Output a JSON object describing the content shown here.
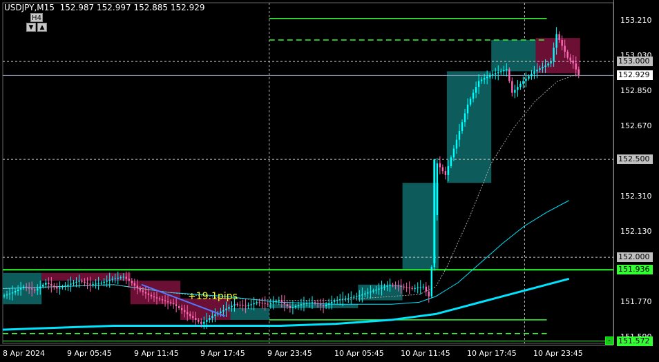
{
  "header": {
    "symbol": "USDJPY,M15",
    "ohlc": "152.987 152.997 152.885 152.929"
  },
  "timeframe": {
    "label": "H4",
    "down_glyph": "▼",
    "up_glyph": "▲"
  },
  "annotation": {
    "pips": "+19.1pips"
  },
  "minimize_glyph": "-",
  "colors": {
    "background": "#000000",
    "bull_box": "#0e5b5b",
    "bear_box": "#6b0f35",
    "candle": "#00ffff",
    "candle_bear": "#ff69b4",
    "level_green": "#33ff33",
    "ma_fast": "#00e5ff",
    "ma_slow": "#00e5ff"
  },
  "chart_data": {
    "type": "candlestick",
    "symbol": "USDJPY",
    "timeframe": "M15",
    "y_ticks": [
      "153.210",
      "153.030",
      "152.850",
      "152.670",
      "152.310",
      "152.130",
      "151.770",
      "151.590"
    ],
    "x_ticks": [
      "8 Apr 2024",
      "9 Apr 05:45",
      "9 Apr 11:45",
      "9 Apr 17:45",
      "9 Apr 23:45",
      "10 Apr 05:45",
      "10 Apr 11:45",
      "10 Apr 17:45",
      "10 Apr 23:45"
    ],
    "ylim": [
      151.56,
      153.3
    ],
    "current_price": "152.929",
    "price_labels": [
      {
        "value": "153.000",
        "kind": "level"
      },
      {
        "value": "152.929",
        "kind": "current"
      },
      {
        "value": "152.500",
        "kind": "level"
      },
      {
        "value": "152.000",
        "kind": "level"
      },
      {
        "value": "151.936",
        "kind": "green"
      },
      {
        "value": "151.572",
        "kind": "green"
      }
    ],
    "horizontal_levels": [
      {
        "price": 153.0,
        "style": "dotted"
      },
      {
        "price": 152.5,
        "style": "dotted"
      },
      {
        "price": 152.0,
        "style": "dotted"
      },
      {
        "price": 151.936,
        "style": "solid-green"
      },
      {
        "price": 151.572,
        "style": "solid-green"
      }
    ],
    "close_path": [
      [
        0,
        151.8
      ],
      [
        4,
        151.82
      ],
      [
        8,
        151.85
      ],
      [
        12,
        151.83
      ],
      [
        16,
        151.87
      ],
      [
        20,
        151.84
      ],
      [
        24,
        151.86
      ],
      [
        28,
        151.88
      ],
      [
        32,
        151.86
      ],
      [
        36,
        151.87
      ],
      [
        40,
        151.89
      ],
      [
        44,
        151.9
      ],
      [
        46,
        151.88
      ],
      [
        50,
        151.83
      ],
      [
        54,
        151.8
      ],
      [
        58,
        151.78
      ],
      [
        62,
        151.76
      ],
      [
        66,
        151.72
      ],
      [
        70,
        151.68
      ],
      [
        72,
        151.66
      ],
      [
        76,
        151.7
      ],
      [
        80,
        151.73
      ],
      [
        84,
        151.76
      ],
      [
        88,
        151.75
      ],
      [
        92,
        151.77
      ],
      [
        96,
        151.76
      ],
      [
        100,
        151.78
      ],
      [
        104,
        151.74
      ],
      [
        108,
        151.76
      ],
      [
        112,
        151.77
      ],
      [
        116,
        151.75
      ],
      [
        120,
        151.78
      ],
      [
        124,
        151.79
      ],
      [
        128,
        151.8
      ],
      [
        132,
        151.82
      ],
      [
        136,
        151.84
      ],
      [
        140,
        151.86
      ],
      [
        144,
        151.85
      ],
      [
        148,
        151.84
      ],
      [
        152,
        151.85
      ],
      [
        154,
        151.8
      ],
      [
        155,
        151.95
      ],
      [
        157,
        152.48
      ],
      [
        160,
        152.42
      ],
      [
        164,
        152.6
      ],
      [
        168,
        152.78
      ],
      [
        172,
        152.9
      ],
      [
        176,
        152.93
      ],
      [
        180,
        152.95
      ],
      [
        182,
        152.96
      ],
      [
        184,
        152.84
      ],
      [
        188,
        152.9
      ],
      [
        192,
        152.95
      ],
      [
        196,
        152.98
      ],
      [
        198,
        153.0
      ],
      [
        200,
        153.14
      ],
      [
        202,
        153.08
      ],
      [
        204,
        153.02
      ],
      [
        206,
        152.99
      ],
      [
        208,
        152.929
      ]
    ],
    "ma_fast": [
      [
        0,
        151.84
      ],
      [
        20,
        151.85
      ],
      [
        40,
        151.86
      ],
      [
        60,
        151.82
      ],
      [
        80,
        151.79
      ],
      [
        100,
        151.78
      ],
      [
        120,
        151.78
      ],
      [
        140,
        151.8
      ],
      [
        150,
        151.81
      ],
      [
        156,
        151.85
      ],
      [
        160,
        151.95
      ],
      [
        168,
        152.2
      ],
      [
        176,
        152.48
      ],
      [
        184,
        152.66
      ],
      [
        192,
        152.8
      ],
      [
        200,
        152.9
      ],
      [
        208,
        152.94
      ]
    ],
    "ma_mid": [
      [
        0,
        151.84
      ],
      [
        20,
        151.85
      ],
      [
        40,
        151.86
      ],
      [
        60,
        151.82
      ],
      [
        80,
        151.8
      ],
      [
        100,
        151.77
      ],
      [
        120,
        151.76
      ],
      [
        140,
        151.76
      ],
      [
        150,
        151.77
      ],
      [
        156,
        151.8
      ],
      [
        164,
        151.87
      ],
      [
        172,
        151.97
      ],
      [
        180,
        152.07
      ],
      [
        188,
        152.16
      ],
      [
        196,
        152.23
      ],
      [
        204,
        152.29
      ]
    ],
    "ma_slow": [
      [
        0,
        151.63
      ],
      [
        20,
        151.64
      ],
      [
        40,
        151.65
      ],
      [
        60,
        151.65
      ],
      [
        80,
        151.65
      ],
      [
        100,
        151.65
      ],
      [
        120,
        151.66
      ],
      [
        140,
        151.68
      ],
      [
        156,
        151.71
      ],
      [
        164,
        151.74
      ],
      [
        172,
        151.77
      ],
      [
        180,
        151.8
      ],
      [
        188,
        151.83
      ],
      [
        196,
        151.86
      ],
      [
        204,
        151.89
      ]
    ],
    "boxes": [
      {
        "x0": 0,
        "x1": 14,
        "low": 151.76,
        "high": 151.92,
        "kind": "bull"
      },
      {
        "x0": 14,
        "x1": 46,
        "low": 151.88,
        "high": 151.92,
        "kind": "bear"
      },
      {
        "x0": 46,
        "x1": 64,
        "low": 151.76,
        "high": 151.88,
        "kind": "bear"
      },
      {
        "x0": 64,
        "x1": 82,
        "low": 151.68,
        "high": 151.79,
        "kind": "bear"
      },
      {
        "x0": 82,
        "x1": 96,
        "low": 151.68,
        "high": 151.74,
        "kind": "bull"
      },
      {
        "x0": 96,
        "x1": 128,
        "low": 151.74,
        "high": 151.76,
        "kind": "bull"
      },
      {
        "x0": 128,
        "x1": 144,
        "low": 151.78,
        "high": 151.86,
        "kind": "bull"
      },
      {
        "x0": 144,
        "x1": 157,
        "low": 151.94,
        "high": 152.38,
        "kind": "bull"
      },
      {
        "x0": 160,
        "x1": 176,
        "low": 152.38,
        "high": 152.95,
        "kind": "bull"
      },
      {
        "x0": 176,
        "x1": 192,
        "low": 152.95,
        "high": 153.11,
        "kind": "bull"
      },
      {
        "x0": 192,
        "x1": 208,
        "low": 152.94,
        "high": 153.12,
        "kind": "bear"
      }
    ],
    "green_lines": [
      {
        "x0": 96,
        "x1": 196,
        "price": 153.22,
        "style": "solid"
      },
      {
        "x0": 96,
        "x1": 196,
        "price": 153.11,
        "style": "dashed"
      },
      {
        "x0": 96,
        "x1": 196,
        "price": 151.68,
        "style": "solid"
      },
      {
        "x0": 0,
        "x1": 196,
        "price": 151.61,
        "style": "dashed"
      }
    ],
    "trend_segment": {
      "from": [
        50,
        151.86
      ],
      "to": [
        80,
        151.7
      ]
    },
    "x_max": 220
  }
}
